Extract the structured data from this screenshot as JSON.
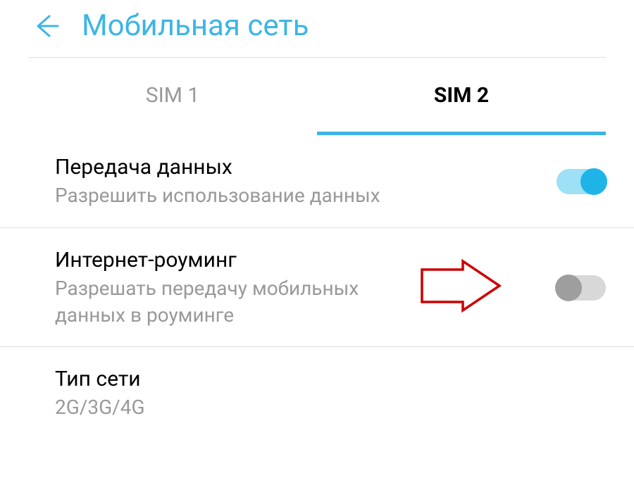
{
  "header": {
    "title": "Мобильная сеть"
  },
  "tabs": {
    "sim1": "SIM 1",
    "sim2": "SIM 2"
  },
  "settings": {
    "dataTransfer": {
      "title": "Передача данных",
      "subtitle": "Разрешить использование данных"
    },
    "roaming": {
      "title": "Интернет-роуминг",
      "subtitle": "Разрешать передачу мобильных данных в роуминге"
    },
    "networkType": {
      "title": "Тип сети",
      "subtitle": "2G/3G/4G"
    }
  },
  "colors": {
    "accent": "#3db5e6",
    "arrow": "#cc0000"
  }
}
